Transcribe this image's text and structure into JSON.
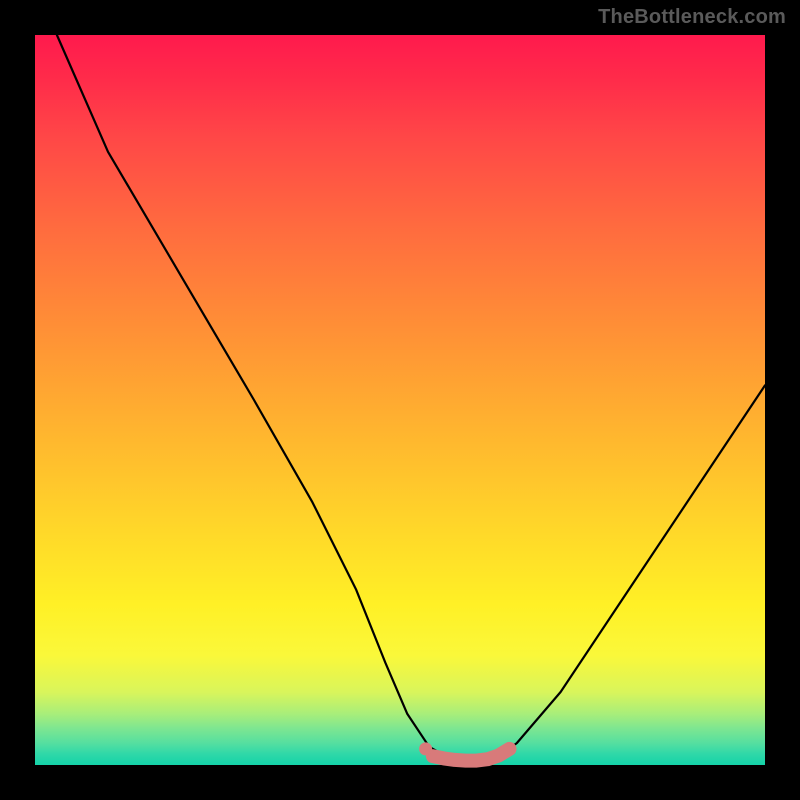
{
  "watermark": "TheBottleneck.com",
  "colors": {
    "frame": "#000000",
    "curve": "#000000",
    "marker": "#d87a7a",
    "marker_stroke": "#d87a7a"
  },
  "chart_data": {
    "type": "line",
    "title": "",
    "xlabel": "",
    "ylabel": "",
    "xlim": [
      0,
      100
    ],
    "ylim": [
      0,
      100
    ],
    "grid": false,
    "series": [
      {
        "name": "bottleneck-curve",
        "x": [
          3,
          10,
          20,
          30,
          38,
          44,
          48,
          51,
          54,
          57,
          60,
          63,
          66,
          72,
          80,
          90,
          100
        ],
        "y": [
          100,
          84,
          67,
          50,
          36,
          24,
          14,
          7,
          2.5,
          0.8,
          0.5,
          0.8,
          3,
          10,
          22,
          37,
          52
        ]
      }
    ],
    "markers": {
      "name": "highlight-band",
      "x": [
        54.5,
        56,
        57.5,
        59,
        60.5,
        62,
        63.5,
        65
      ],
      "y": [
        1.2,
        0.9,
        0.7,
        0.6,
        0.6,
        0.8,
        1.3,
        2.2
      ]
    },
    "single_marker": {
      "x": 53.5,
      "y": 2.2
    }
  }
}
